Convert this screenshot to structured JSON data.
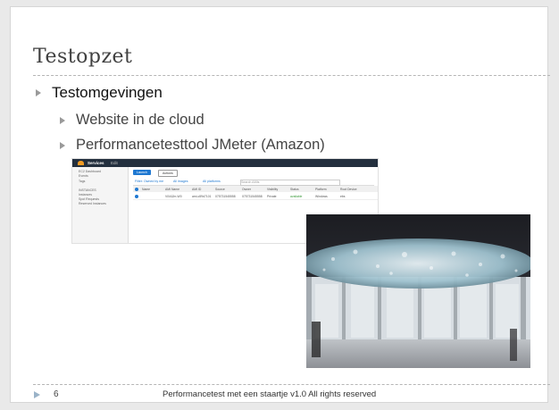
{
  "slide": {
    "title": "Testopzet",
    "bullets": {
      "level1": "Testomgevingen",
      "level2": [
        "Website in de cloud",
        "Performancetesttool JMeter (Amazon)"
      ]
    },
    "footer": {
      "page_number": "6",
      "text": "Performancetest met een staartje v1.0   All rights reserved"
    }
  },
  "screenshot": {
    "topbar": {
      "services": "Services",
      "edit": "Edit"
    },
    "sidebar": [
      "EC2 Dashboard",
      "Events",
      "Tags",
      "INSTANCES",
      "Instances",
      "Spot Requests",
      "Reserved Instances"
    ],
    "buttons": {
      "launch": "Launch",
      "actions": "Actions"
    },
    "filters": [
      "Filter: Owned by me",
      "All images",
      "All platforms",
      "Search AMIs"
    ],
    "columns": [
      "Name",
      "AMI Name",
      "AMI ID",
      "Source",
      "Owner",
      "Visibility",
      "Status",
      "Platform",
      "Root Device"
    ],
    "row": [
      "",
      "ViXAZm-W0",
      "ami-c59d7101",
      "075731545558",
      "075731545558",
      "Private",
      "available",
      "Windows",
      "ebs"
    ]
  },
  "colors": {
    "accent_blue": "#1f78d1",
    "aws_dark": "#232f3e",
    "aws_orange": "#f29b24"
  }
}
